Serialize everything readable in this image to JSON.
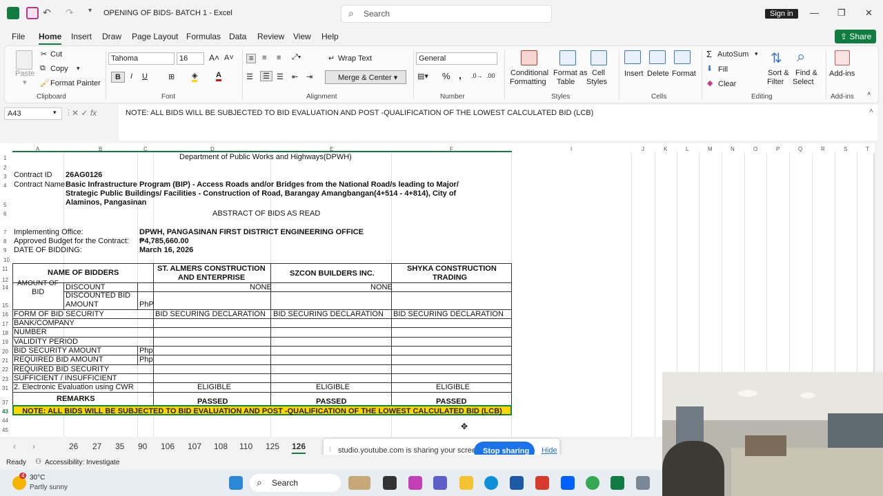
{
  "window": {
    "title": "OPENING OF BIDS- BATCH 1  -  Excel",
    "search_placeholder": "Search",
    "signin": "Sign in",
    "share": "Share"
  },
  "menu": [
    "File",
    "Home",
    "Insert",
    "Draw",
    "Page Layout",
    "Formulas",
    "Data",
    "Review",
    "View",
    "Help"
  ],
  "ribbon": {
    "clipboard": {
      "paste": "Paste",
      "cut": "Cut",
      "copy": "Copy",
      "format_painter": "Format Painter",
      "label": "Clipboard"
    },
    "font": {
      "name": "Tahoma",
      "size": "16",
      "label": "Font",
      "bold": "B",
      "italic": "I",
      "underline": "U"
    },
    "alignment": {
      "wrap": "Wrap Text",
      "merge": "Merge & Center",
      "label": "Alignment"
    },
    "number": {
      "format": "General",
      "label": "Number",
      "percent": "%",
      "comma": ","
    },
    "styles": {
      "conditional": [
        "Conditional",
        "Formatting"
      ],
      "format_table": [
        "Format as",
        "Table"
      ],
      "cell_styles": [
        "Cell",
        "Styles"
      ],
      "label": "Styles"
    },
    "cells": {
      "insert": "Insert",
      "delete": "Delete",
      "format": "Format",
      "label": "Cells"
    },
    "editing": {
      "autosum": "AutoSum",
      "fill": "Fill",
      "clear": "Clear",
      "sort": [
        "Sort &",
        "Filter"
      ],
      "find": [
        "Find &",
        "Select"
      ],
      "label": "Editing"
    },
    "addins": {
      "addins": "Add-ins",
      "label": "Add-ins"
    }
  },
  "formula_bar": {
    "name_box": "A43",
    "fx": "fx",
    "formula": "NOTE: ALL BIDS WILL BE SUBJECTED TO BID EVALUATION AND POST -QUALIFICATION OF THE LOWEST CALCULATED BID (LCB)"
  },
  "columns": [
    "A",
    "B",
    "C",
    "D",
    "E",
    "F",
    "I",
    "J",
    "K",
    "L",
    "M",
    "N",
    "O",
    "P",
    "Q",
    "R",
    "S",
    "T"
  ],
  "rows": [
    "1",
    "2",
    "3",
    "4",
    "5",
    "6",
    "7",
    "8",
    "9",
    "10",
    "11",
    "12",
    "14",
    "15",
    "16",
    "17",
    "18",
    "19",
    "20",
    "21",
    "22",
    "23",
    "31",
    "37",
    "43",
    "44",
    "45"
  ],
  "sheet": {
    "agency": "Department of Public Works and Highways(DPWH)",
    "contract_id_label": "Contract ID",
    "contract_id": "26AG0126",
    "contract_name_label": "Contract Name",
    "contract_name": [
      "Basic Infrastructure Program (BIP) - Access Roads and/or Bridges from the National Road/s leading to Major/",
      "Strategic Public Buildings/ Facilities - Construction of Road, Barangay Amangbangan(4+514 - 4+814), City of",
      "Alaminos, Pangasinan"
    ],
    "abstract_title": "ABSTRACT OF BIDS AS READ",
    "implementing_label": "Implementing Office:",
    "implementing": "DPWH, PANGASINAN FIRST DISTRICT ENGINEERING OFFICE",
    "abc_label": "Approved Budget for the Contract:",
    "abc": "₱4,785,660.00",
    "date_label": "DATE OF BIDDING:",
    "date": "March 16, 2026",
    "name_of_bidders": "NAME OF BIDDERS",
    "bidders": [
      [
        "ST. ALMERS CONSTRUCTION",
        "AND ENTERPRISE"
      ],
      [
        "SZCON BUILDERS INC."
      ],
      [
        "SHYKA CONSTRUCTION",
        "TRADING"
      ]
    ],
    "amount_of_bid": [
      "AMOUNT OF",
      "BID"
    ],
    "discount": "DISCOUNT",
    "discount_values": [
      "NONE",
      "NONE"
    ],
    "discounted_bid": [
      "DISCOUNTED BID",
      "AMOUNT"
    ],
    "php": "PhP",
    "php2": "Php",
    "form_of_bid_security": "FORM OF BID SECURITY",
    "bid_securing": [
      "BID SECURING DECLARATION",
      "BID SECURING DECLARATION",
      "BID SECURING DECLARATION"
    ],
    "bank": "BANK/COMPANY",
    "number": "NUMBER",
    "validity": "VALIDITY PERIOD",
    "bid_security_amount": "BID SECURITY AMOUNT",
    "required_bid_amount": "REQUIRED BID AMOUNT",
    "required_bid_security": "REQUIRED BID SECURITY",
    "sufficient": "SUFFICIENT / INSUFFICIENT",
    "electronic": "2. Electronic Evaluation using CWR",
    "eligible": [
      "ELIGIBLE",
      "ELIGIBLE",
      "ELIGIBLE"
    ],
    "remarks": "REMARKS",
    "passed": [
      "PASSED",
      "PASSED",
      "PASSED"
    ],
    "note": "NOTE: ALL BIDS WILL BE SUBJECTED TO BID EVALUATION AND POST -QUALIFICATION OF THE LOWEST CALCULATED BID (LCB)"
  },
  "sheet_tabs": [
    "26",
    "27",
    "35",
    "90",
    "106",
    "107",
    "108",
    "110",
    "125",
    "126"
  ],
  "active_tab": "126",
  "screen_share": {
    "message": "studio.youtube.com is sharing your screen.",
    "stop": "Stop sharing",
    "hide": "Hide"
  },
  "status": {
    "ready": "Ready",
    "accessibility": "Accessibility: Investigate"
  },
  "taskbar": {
    "temp": "30°C",
    "weather": "Partly sunny",
    "badge": "4",
    "search": "Search"
  }
}
